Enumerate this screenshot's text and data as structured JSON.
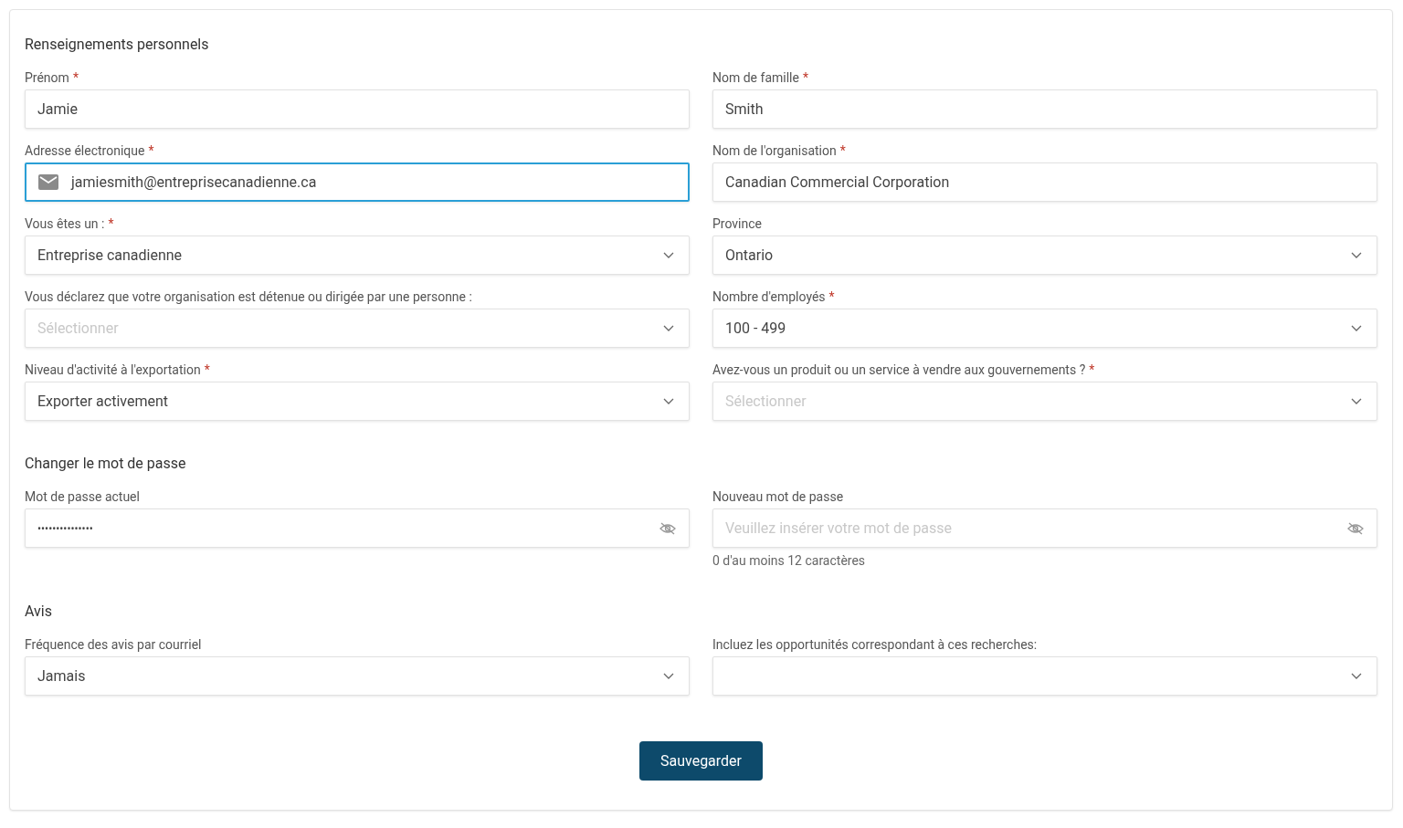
{
  "sections": [
    {
      "title": "Renseignements personnels",
      "fields": [
        {
          "kind": "text",
          "label": "Prénom",
          "mark": "*",
          "value": "Jamie"
        },
        {
          "kind": "text",
          "label": "Nom de famille",
          "mark": "*",
          "value": "Smith"
        },
        {
          "kind": "email",
          "label": "Adresse électronique",
          "mark": "*",
          "value": "jamiesmith@entreprisecanadienne.ca",
          "focused": true
        },
        {
          "kind": "text",
          "label": "Nom de l'organisation",
          "mark": "*",
          "value": "Canadian Commercial Corporation"
        },
        {
          "kind": "select",
          "label": "Vous êtes un :",
          "mark": "*",
          "value": "Entreprise canadienne"
        },
        {
          "kind": "select",
          "label": "Province",
          "value": "Ontario"
        },
        {
          "kind": "select",
          "label": "Vous déclarez que votre organisation est détenue ou dirigée par une personne :",
          "placeholder": "Sélectionner"
        },
        {
          "kind": "select",
          "label": "Nombre d'employés",
          "mark": "*",
          "value": "100 - 499"
        },
        {
          "kind": "select",
          "label": "Niveau d'activité à l'exportation",
          "mark": "*",
          "value": "Exporter activement"
        },
        {
          "kind": "select",
          "label": "Avez-vous un produit ou un service à vendre aux gouvernements ?",
          "mark": "*",
          "placeholder": "Sélectionner"
        }
      ]
    },
    {
      "title": "Changer le mot de passe",
      "fields": [
        {
          "kind": "password",
          "label": "Mot de passe actuel",
          "value": "•••••••••••••••"
        },
        {
          "kind": "password",
          "label": "Nouveau mot de passe",
          "placeholder": "Veuillez insérer votre mot de passe",
          "hint": "0 d'au moins 12 caractères"
        }
      ]
    },
    {
      "title": "Avis",
      "fields": [
        {
          "kind": "select",
          "label": "Fréquence des avis par courriel",
          "value": "Jamais"
        },
        {
          "kind": "select",
          "label": "Incluez les opportunités correspondant à ces recherches:"
        }
      ]
    }
  ],
  "save_button": "Sauvegarder"
}
